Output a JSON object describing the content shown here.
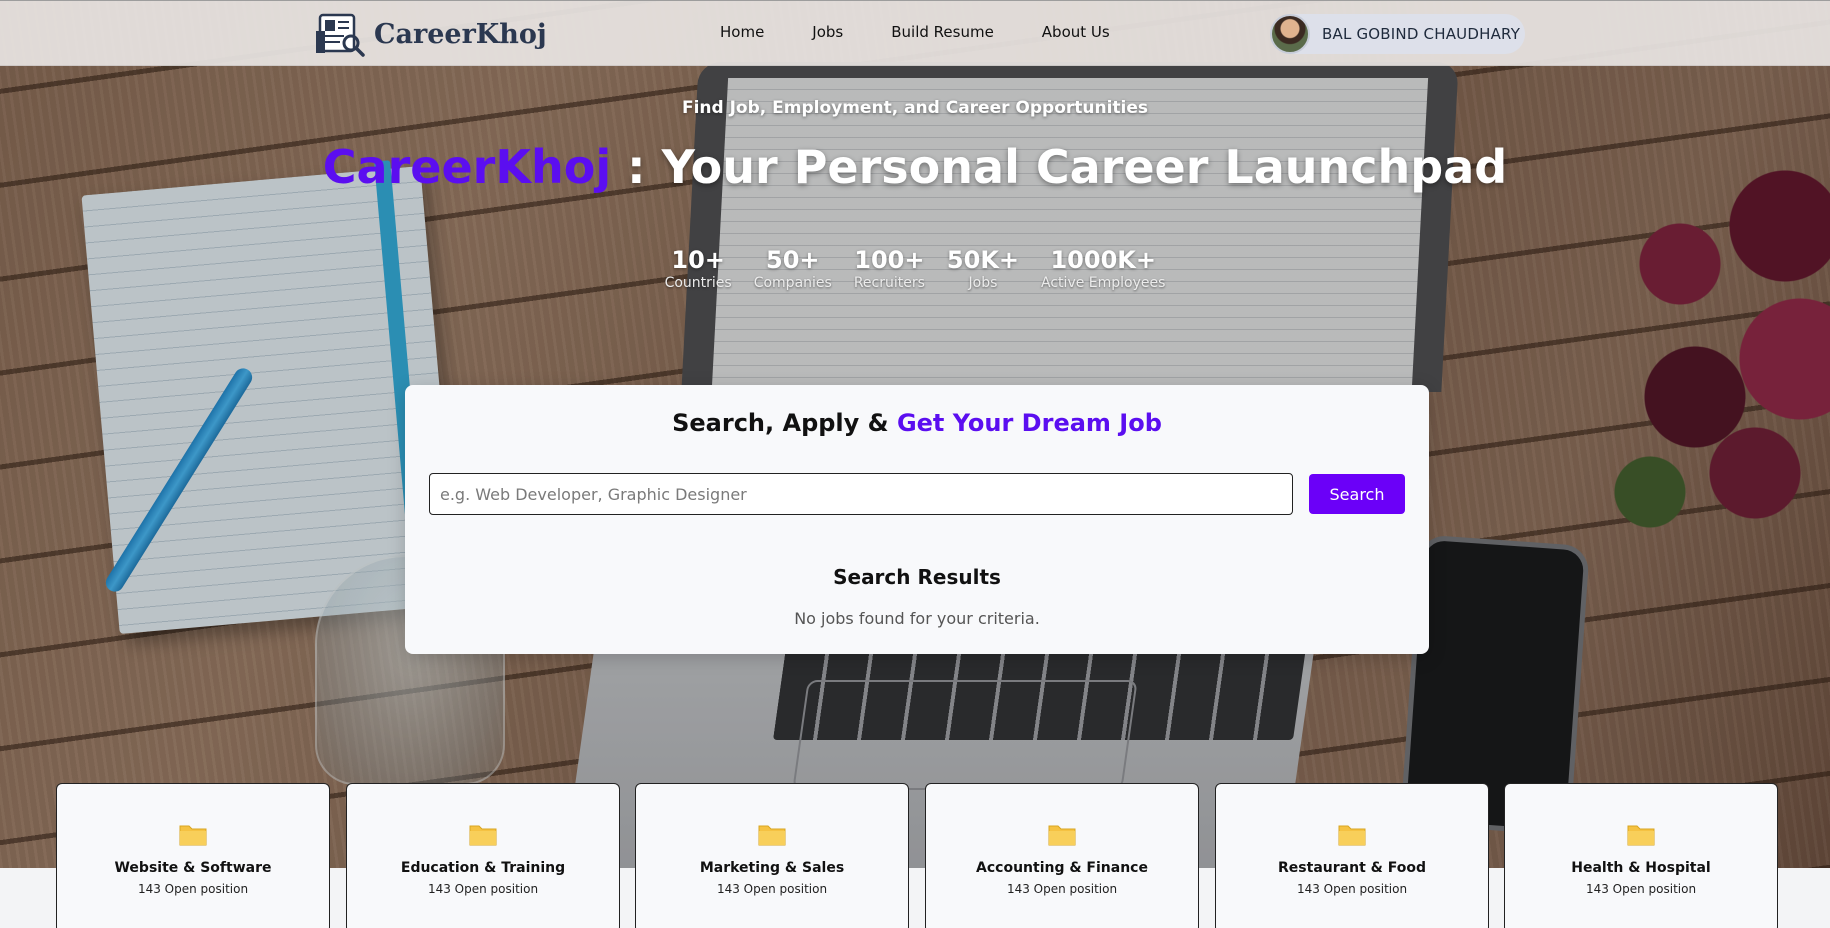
{
  "brand": {
    "name": "CareerKhoj"
  },
  "nav": {
    "links": [
      "Home",
      "Jobs",
      "Build Resume",
      "About Us"
    ]
  },
  "user": {
    "name": "BAL GOBIND CHAUDHARY"
  },
  "hero": {
    "tagline": "Find Job, Employment, and Career Opportunities",
    "headline_brand": "CareerKhoj",
    "headline_rest": " : Your Personal Career Launchpad",
    "stats": [
      {
        "value": "10+",
        "label": "Countries"
      },
      {
        "value": "50+",
        "label": "Companies"
      },
      {
        "value": "100+",
        "label": "Recruiters"
      },
      {
        "value": "50K+",
        "label": "Jobs"
      },
      {
        "value": "1000K+",
        "label": "Active Employees"
      }
    ]
  },
  "search": {
    "title_prefix": "Search, Apply & ",
    "title_accent": "Get Your Dream Job",
    "placeholder": "e.g. Web Developer, Graphic Designer",
    "value": "",
    "button_label": "Search",
    "results_title": "Search Results",
    "results_empty": "No jobs found for your criteria."
  },
  "categories": [
    {
      "title": "Website & Software",
      "count": "143 Open position",
      "icon": "folder-icon"
    },
    {
      "title": "Education & Training",
      "count": "143 Open position",
      "icon": "folder-icon"
    },
    {
      "title": "Marketing & Sales",
      "count": "143 Open position",
      "icon": "folder-icon"
    },
    {
      "title": "Accounting & Finance",
      "count": "143 Open position",
      "icon": "folder-icon"
    },
    {
      "title": "Restaurant & Food",
      "count": "143 Open position",
      "icon": "folder-icon"
    },
    {
      "title": "Health & Hospital",
      "count": "143 Open position",
      "icon": "folder-icon"
    }
  ],
  "colors": {
    "accent": "#5b0ef0",
    "button": "#6b00f8",
    "folder": "#f5c242"
  }
}
